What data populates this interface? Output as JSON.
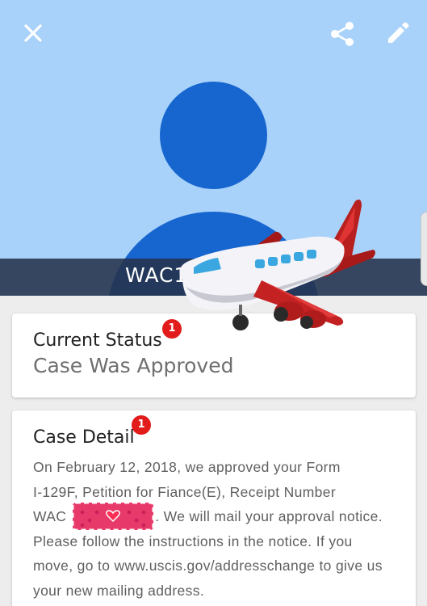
{
  "header": {
    "title": "WAC1",
    "close_icon": "close-icon",
    "share_icon": "share-icon",
    "edit_icon": "pencil-icon",
    "avatar_icon": "person-avatar-icon"
  },
  "status_card": {
    "title": "Current Status",
    "value": "Case Was Approved",
    "badge": "1"
  },
  "detail_card": {
    "title": "Case Detail",
    "badge": "1",
    "lines": [
      "On February 12, 2018, we approved your Form",
      "I-129F, Petition for Fiance(E), Receipt Number",
      "WAC",
      ". We will mail your approval notice.",
      "Please follow the instructions in the notice. If you",
      "move, go to www.uscis.gov/addresschange to give us",
      "your new mailing address."
    ]
  },
  "stickers": {
    "redaction": "heart-pattern-sticker",
    "airplane": "airplane-sticker"
  },
  "colors": {
    "header_bg": "#a8d2fa",
    "avatar": "#1766cf",
    "badge": "#e21b1b",
    "page_bg": "#ededed"
  }
}
